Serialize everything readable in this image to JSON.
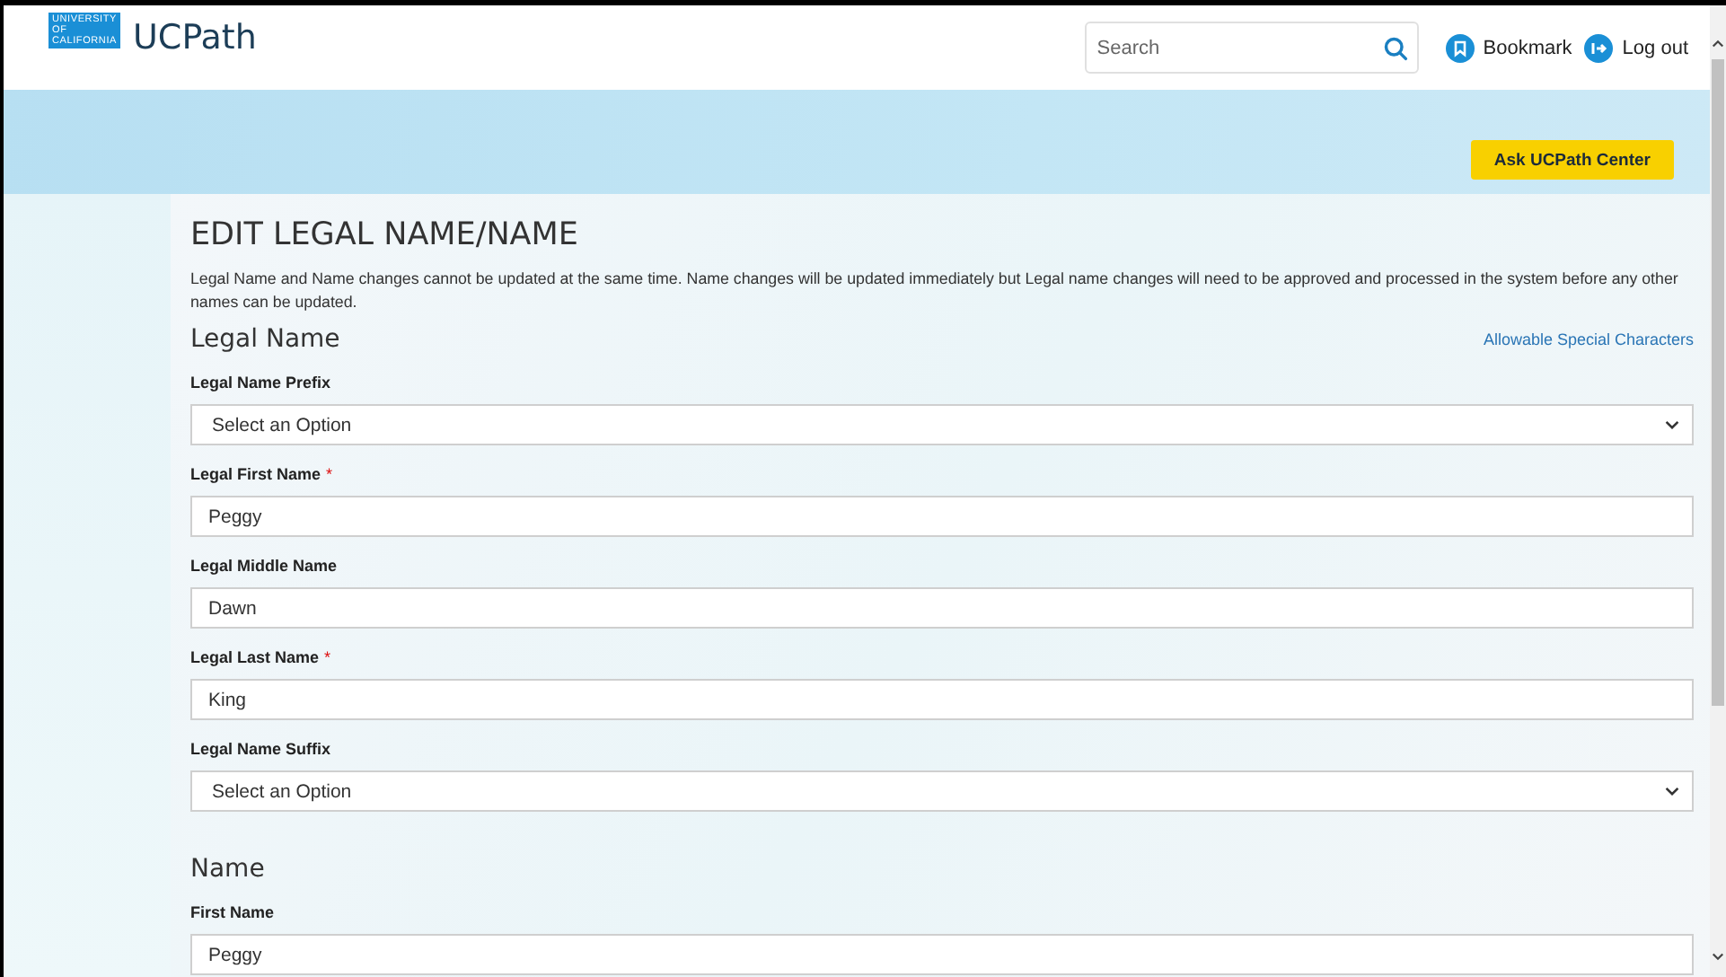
{
  "header": {
    "logo_lines": [
      "UNIVERSITY",
      "OF",
      "CALIFORNIA"
    ],
    "app_name": "UCPath",
    "search": {
      "placeholder": "Search"
    },
    "links": [
      {
        "kind": "bookmark",
        "label": "Bookmark"
      },
      {
        "kind": "logout",
        "label": "Log out"
      }
    ]
  },
  "banner": {
    "button": "Ask UCPath Center"
  },
  "form": {
    "title": "EDIT LEGAL NAME/NAME",
    "intro": "Legal Name and Name changes cannot be updated at the same time. Name changes will be updated immediately but Legal name changes will need to be approved and processed in the system before any other names can be updated.",
    "sections": [
      {
        "heading": "Legal Name",
        "link": "Allowable Special Characters",
        "fields": [
          {
            "kind": "select",
            "label": "Legal Name Prefix",
            "value": "Select an Option"
          },
          {
            "kind": "text",
            "label": "Legal First Name",
            "required_mark": "*",
            "value": "Peggy"
          },
          {
            "kind": "text",
            "label": "Legal Middle Name",
            "value": "Dawn"
          },
          {
            "kind": "text",
            "label": "Legal Last Name",
            "required_mark": "*",
            "value": "King"
          },
          {
            "kind": "select",
            "label": "Legal Name Suffix",
            "value": "Select an Option"
          }
        ]
      },
      {
        "heading": "Name",
        "fields": [
          {
            "kind": "text",
            "label": "First Name",
            "value": "Peggy"
          }
        ]
      }
    ]
  }
}
